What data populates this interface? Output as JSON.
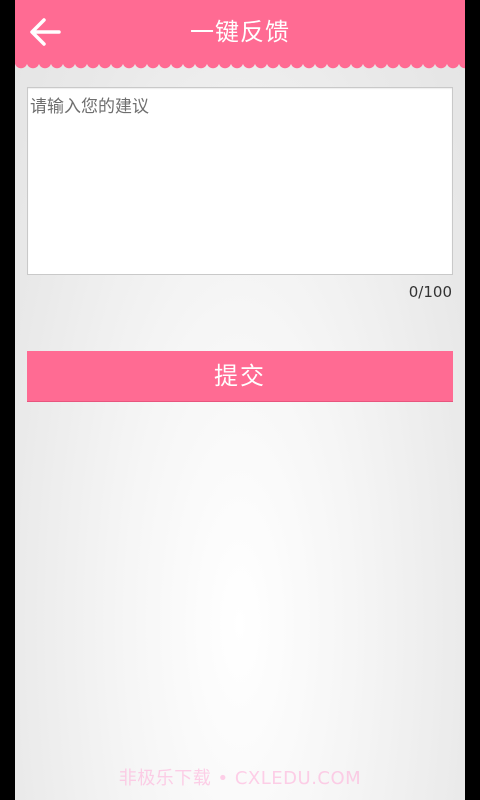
{
  "header": {
    "title": "一键反馈",
    "back_icon": "back-arrow-icon",
    "color": "#ff6b93"
  },
  "feedback": {
    "value": "",
    "placeholder": "请输入您的建议",
    "counter": "0/100"
  },
  "actions": {
    "submit_label": "提交"
  },
  "watermark": "非极乐下载 • CXLEDU.COM"
}
